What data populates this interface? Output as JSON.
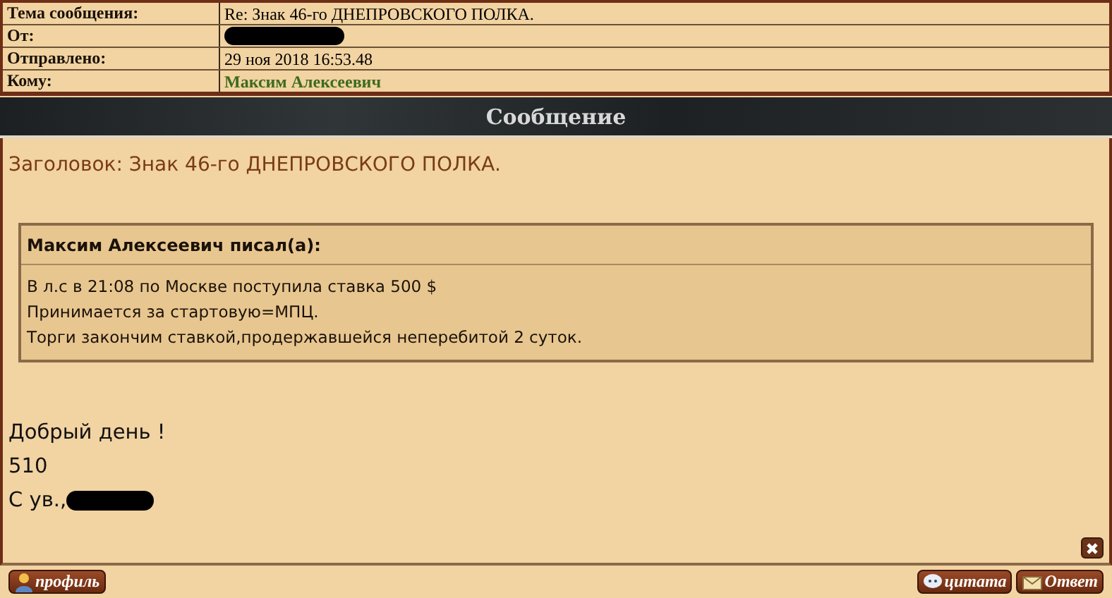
{
  "header_fields": [
    {
      "label": "Тема сообщения:",
      "value": "Re: Знак 46-го ДНЕПРОВСКОГО ПОЛКА.",
      "kind": "text"
    },
    {
      "label": "От:",
      "kind": "redacted"
    },
    {
      "label": "Отправлено:",
      "value": "29 ноя 2018 16:53.48",
      "kind": "text"
    },
    {
      "label": "Кому:",
      "value": "Максим Алексеевич",
      "kind": "name"
    }
  ],
  "section_title": "Сообщение",
  "subject_line": "Заголовок: Знак 46-го ДНЕПРОВСКОГО ПОЛКА.",
  "quote": {
    "author": "Максим Алексеевич писал(а):",
    "lines": [
      "В л.с в 21:08 по Москве поступила ставка 500 $",
      "Принимается за стартовую=МПЦ.",
      "Торги закончим ставкой,продержавшейся неперебитой 2 суток."
    ]
  },
  "body_lines": [
    {
      "text": "Добрый день !",
      "redacted_after": false
    },
    {
      "text": "510",
      "redacted_after": false
    },
    {
      "text": "С ув.,",
      "redacted_after": true
    }
  ],
  "footer": {
    "profile_button": "профиль",
    "quote_button": "цитата",
    "reply_button": "Ответ"
  }
}
